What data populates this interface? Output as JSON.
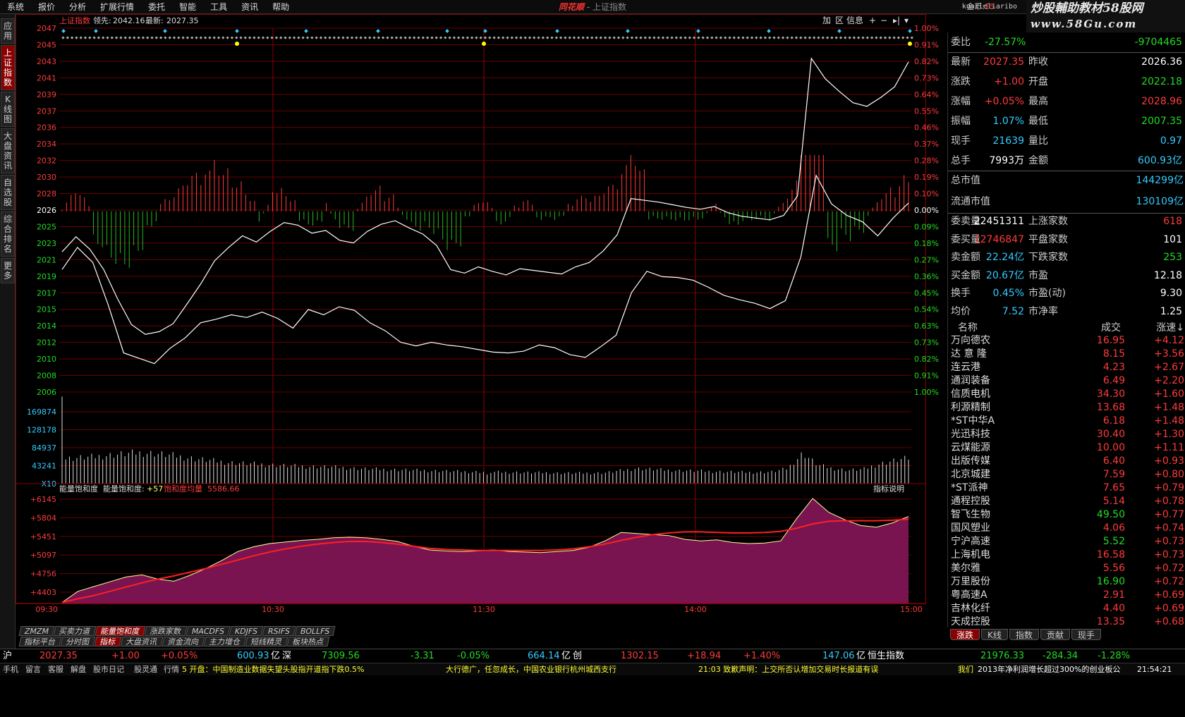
{
  "menu": [
    "系统",
    "报价",
    "分析",
    "扩展行情",
    "委托",
    "智能",
    "工具",
    "资讯",
    "帮助"
  ],
  "title": {
    "logo": "同花顺",
    "sep": " - ",
    "name": "上证指数"
  },
  "coin": {
    "label": "金币:",
    "value": "15"
  },
  "user": "kuaileliaribo",
  "watermark": {
    "line1": "炒股輔助教材58股网",
    "line2": "www.58Gu.com"
  },
  "left_tabs": [
    {
      "label": "应用",
      "active": false
    },
    {
      "label": "上证指数",
      "active": true
    },
    {
      "label": "K线图",
      "active": false
    },
    {
      "label": "大盘资讯",
      "active": false
    },
    {
      "label": "自选股",
      "active": false
    },
    {
      "label": "综合排名",
      "active": false
    },
    {
      "label": "更多",
      "active": false
    }
  ],
  "chart_header": {
    "name": "上证指数",
    "lead_label": "领先:",
    "lead": "2042.16",
    "latest_label": "最新:",
    "latest": "2027.35",
    "buttons": [
      "加",
      "区",
      "信息",
      "+",
      "−",
      "▸|",
      "▾"
    ]
  },
  "chart_data": [
    {
      "type": "line",
      "name": "intraday-price",
      "y_ticks": [
        "2047",
        "2045",
        "2043",
        "2041",
        "2039",
        "2037",
        "2036",
        "2034",
        "2032",
        "2030",
        "2028",
        "2026",
        "2025",
        "2023",
        "2021",
        "2019",
        "2017",
        "2015",
        "2014",
        "2012",
        "2010",
        "2008",
        "2006"
      ],
      "pct_ticks": [
        "1.00%",
        "0.91%",
        "0.82%",
        "0.73%",
        "0.64%",
        "0.55%",
        "0.46%",
        "0.37%",
        "0.28%",
        "0.19%",
        "0.10%",
        "0.00%",
        "0.09%",
        "0.18%",
        "0.27%",
        "0.36%",
        "0.45%",
        "0.54%",
        "0.63%",
        "0.73%",
        "0.82%",
        "0.91%",
        "1.00%"
      ],
      "ylim": [
        2006,
        2047
      ],
      "prev_close": 2026.36,
      "series": [
        {
          "values": [
            2021.8,
            2023.5,
            2022.1,
            2019.8,
            2016.5,
            2013.6,
            2012.5,
            2012.8,
            2013.7,
            2015.9,
            2018.2,
            2020.8,
            2022.3,
            2023.6,
            2022.9,
            2024.1,
            2025.1,
            2024.8,
            2023.9,
            2024.2,
            2023.1,
            2022.8,
            2024.1,
            2024.9,
            2025.3,
            2024.5,
            2023.8,
            2022.5,
            2019.8,
            2019.4,
            2020.1,
            2019.6,
            2019.2,
            2019.9,
            2019.7,
            2019.5,
            2019.3,
            2020.1,
            2020.6,
            2021.9,
            2023.7,
            2027.8,
            2027.6,
            2027.4,
            2027.1,
            2026.8,
            2026.6,
            2026.9,
            2026.2,
            2025.8,
            2025.6,
            2025.4,
            2025.9,
            2028.1,
            2043.6,
            2041.3,
            2039.9,
            2038.6,
            2038.2,
            2039.2,
            2040.4,
            2043.2
          ]
        },
        {
          "values": [
            2019.8,
            2022.3,
            2020.6,
            2015.8,
            2010.4,
            2009.8,
            2009.2,
            2010.9,
            2012.1,
            2013.8,
            2014.2,
            2014.7,
            2014.4,
            2015.0,
            2014.3,
            2013.2,
            2015.3,
            2014.7,
            2015.6,
            2015.2,
            2013.8,
            2012.9,
            2011.6,
            2011.2,
            2011.6,
            2011.3,
            2011.1,
            2010.8,
            2010.5,
            2010.4,
            2010.6,
            2011.3,
            2011.0,
            2010.2,
            2009.9,
            2011.1,
            2012.4,
            2017.2,
            2019.6,
            2019.0,
            2018.9,
            2018.6,
            2017.8,
            2016.9,
            2016.4,
            2016.0,
            2015.4,
            2016.3,
            2021.2,
            2030.4,
            2027.2,
            2025.9,
            2025.2,
            2023.6,
            2025.6,
            2027.3
          ]
        }
      ]
    },
    {
      "type": "bar",
      "name": "volume",
      "y_ticks": [
        "169874",
        "128178",
        "84937",
        "43241",
        "X10"
      ],
      "ylim": [
        0,
        212000
      ],
      "values": [
        58000,
        61000,
        63000,
        67000,
        70000,
        73000,
        72000,
        68000,
        63000,
        58000,
        54000,
        50000,
        48000,
        46000,
        44000,
        42000,
        41000,
        40000,
        39000,
        37000,
        35000,
        34000,
        33000,
        32000,
        31000,
        30000,
        29000,
        28000,
        28000,
        27000,
        27000,
        26000,
        26000,
        25000,
        25000,
        25000,
        26000,
        31000,
        36000,
        34000,
        32000,
        31000,
        30000,
        29000,
        28000,
        27000,
        27000,
        28000,
        36000,
        72000,
        44000,
        36000,
        32000,
        34000,
        46000,
        54000,
        60000
      ]
    },
    {
      "type": "area",
      "name": "energy-saturation",
      "label": "能量饱和度",
      "value_label": "能量饱和度:",
      "value": "+57",
      "ma_label": "饱和度均量",
      "ma_value": "5586.66",
      "y_ticks": [
        "+6145",
        "+5804",
        "+5451",
        "+5097",
        "+4756",
        "+4403"
      ],
      "ylim": [
        4100,
        6200
      ],
      "values": [
        4120,
        4330,
        4420,
        4510,
        4600,
        4640,
        4560,
        4520,
        4630,
        4760,
        4910,
        5080,
        5170,
        5230,
        5260,
        5290,
        5310,
        5340,
        5350,
        5340,
        5310,
        5270,
        5180,
        5110,
        5090,
        5080,
        5090,
        5110,
        5080,
        5070,
        5060,
        5080,
        5100,
        5160,
        5280,
        5440,
        5420,
        5400,
        5380,
        5310,
        5280,
        5300,
        5250,
        5230,
        5240,
        5280,
        5700,
        6080,
        5820,
        5680,
        5570,
        5540,
        5620,
        5740
      ],
      "ma_values": [
        4120,
        4190,
        4250,
        4330,
        4410,
        4490,
        4560,
        4620,
        4690,
        4760,
        4840,
        4920,
        5000,
        5070,
        5130,
        5180,
        5220,
        5250,
        5270,
        5270,
        5250,
        5220,
        5180,
        5140,
        5120,
        5110,
        5100,
        5100,
        5100,
        5100,
        5100,
        5110,
        5130,
        5170,
        5220,
        5290,
        5350,
        5400,
        5430,
        5450,
        5450,
        5440,
        5430,
        5430,
        5440,
        5460,
        5520,
        5600,
        5650,
        5660,
        5660,
        5660,
        5670,
        5690
      ]
    }
  ],
  "time_axis": [
    "09:30",
    "10:30",
    "11:30",
    "14:00",
    "15:00"
  ],
  "indicator_tabs_row1": [
    {
      "label": "ZMZM",
      "active": false
    },
    {
      "label": "买卖力道",
      "active": false
    },
    {
      "label": "能量饱和度",
      "active": true
    },
    {
      "label": "涨跌家数",
      "active": false
    },
    {
      "label": "MACDFS",
      "active": false
    },
    {
      "label": "KDJFS",
      "active": false
    },
    {
      "label": "RSIFS",
      "active": false
    },
    {
      "label": "BOLLFS",
      "active": false
    }
  ],
  "indicator_tabs_row2": [
    {
      "label": "指标平台",
      "active": false
    },
    {
      "label": "分时图",
      "active": false
    },
    {
      "label": "指标",
      "active": true
    },
    {
      "label": "大盘资讯",
      "active": false
    },
    {
      "label": "资金流向",
      "active": false
    },
    {
      "label": "主力增仓",
      "active": false
    },
    {
      "label": "短线精灵",
      "active": false
    },
    {
      "label": "板块热点",
      "active": false
    }
  ],
  "indicator_help": "指标说明",
  "quote": {
    "weibi": {
      "k": "委比",
      "v1": "-27.57%",
      "v2": "-9704465"
    },
    "rows": [
      {
        "k1": "最新",
        "v1": "2027.35",
        "c1": "#ff3b3b",
        "k2": "昨收",
        "v2": "2026.36",
        "c2": "#ffffff"
      },
      {
        "k1": "涨跌",
        "v1": "+1.00",
        "c1": "#ff3b3b",
        "k2": "开盘",
        "v2": "2022.18",
        "c2": "#22dd22"
      },
      {
        "k1": "涨幅",
        "v1": "+0.05%",
        "c1": "#ff3b3b",
        "k2": "最高",
        "v2": "2028.96",
        "c2": "#ff3b3b"
      },
      {
        "k1": "振幅",
        "v1": "1.07%",
        "c1": "#33ccff",
        "k2": "最低",
        "v2": "2007.35",
        "c2": "#22dd22"
      },
      {
        "k1": "现手",
        "v1": "21639",
        "c1": "#33ccff",
        "k2": "量比",
        "v2": "0.97",
        "c2": "#33ccff"
      },
      {
        "k1": "总手",
        "v1": "7993万",
        "c1": "#ffffff",
        "k2": "金额",
        "v2": "600.93亿",
        "c2": "#33ccff"
      }
    ],
    "mv": [
      {
        "k": "总市值",
        "v": "144299亿"
      },
      {
        "k": "流通市值",
        "v": "130109亿"
      }
    ],
    "rows2": [
      {
        "k1": "委卖量",
        "v1": "22451311",
        "c1": "#ffffff",
        "k2": "上涨家数",
        "v2": "618",
        "c2": "#ff3b3b"
      },
      {
        "k1": "委买量",
        "v1": "12746847",
        "c1": "#ff3b3b",
        "k2": "平盘家数",
        "v2": "101",
        "c2": "#ffffff"
      },
      {
        "k1": "卖金额",
        "v1": "22.24亿",
        "c1": "#33ccff",
        "k2": "下跌家数",
        "v2": "253",
        "c2": "#22dd22"
      },
      {
        "k1": "买金额",
        "v1": "20.67亿",
        "c1": "#33ccff",
        "k2": "市盈",
        "v2": "12.18",
        "c2": "#ffffff"
      },
      {
        "k1": "换手",
        "v1": "0.45%",
        "c1": "#33ccff",
        "k2": "市盈(动)",
        "v2": "9.30",
        "c2": "#ffffff"
      },
      {
        "k1": "均价",
        "v1": "7.52",
        "c1": "#33ccff",
        "k2": "市净率",
        "v2": "1.25",
        "c2": "#ffffff"
      }
    ]
  },
  "stocklist": {
    "headers": [
      "名称",
      "成交",
      "涨速↓"
    ],
    "rows": [
      {
        "n": "万向德农",
        "p": "16.95",
        "c": "+4.12"
      },
      {
        "n": "达 意 隆",
        "p": "8.15",
        "c": "+3.56"
      },
      {
        "n": "连云港",
        "p": "4.23",
        "c": "+2.67"
      },
      {
        "n": "通润装备",
        "p": "6.49",
        "c": "+2.20"
      },
      {
        "n": "信质电机",
        "p": "34.30",
        "c": "+1.60"
      },
      {
        "n": "利源精制",
        "p": "13.68",
        "c": "+1.48"
      },
      {
        "n": "*ST中华A",
        "p": "6.18",
        "c": "+1.48"
      },
      {
        "n": "光迅科技",
        "p": "30.40",
        "c": "+1.30"
      },
      {
        "n": "云煤能源",
        "p": "10.00",
        "c": "+1.11"
      },
      {
        "n": "出版传媒",
        "p": "6.40",
        "c": "+0.93"
      },
      {
        "n": "北京城建",
        "p": "7.59",
        "c": "+0.80"
      },
      {
        "n": "*ST派神",
        "p": "7.65",
        "c": "+0.79"
      },
      {
        "n": "通程控股",
        "p": "5.14",
        "c": "+0.78"
      },
      {
        "n": "智飞生物",
        "p": "49.50",
        "c": "+0.77",
        "pc": "#22dd22"
      },
      {
        "n": "国风塑业",
        "p": "4.06",
        "c": "+0.74"
      },
      {
        "n": "宁沪高速",
        "p": "5.52",
        "c": "+0.73",
        "pc": "#22dd22"
      },
      {
        "n": "上海机电",
        "p": "16.58",
        "c": "+0.73"
      },
      {
        "n": "美尔雅",
        "p": "5.56",
        "c": "+0.72"
      },
      {
        "n": "万里股份",
        "p": "16.90",
        "c": "+0.72",
        "pc": "#22dd22"
      },
      {
        "n": "粤高速A",
        "p": "2.91",
        "c": "+0.69"
      },
      {
        "n": "吉林化纤",
        "p": "4.40",
        "c": "+0.69"
      },
      {
        "n": "天成控股",
        "p": "13.35",
        "c": "+0.68"
      }
    ]
  },
  "right_tabs": [
    {
      "label": "涨跌",
      "active": true
    },
    {
      "label": "K线",
      "active": false
    },
    {
      "label": "指数",
      "active": false
    },
    {
      "label": "贡献",
      "active": false
    },
    {
      "label": "现手",
      "active": false
    }
  ],
  "ticker": {
    "sh_label": "沪",
    "sh_price": "2027.35",
    "sh_chg": "+1.00",
    "sh_pct": "+0.05%",
    "sh_amt": "600.93",
    "sh_unit": "亿",
    "sz_label": "深",
    "sz_price": "7309.56",
    "sz_chg": "-3.31",
    "sz_pct": "-0.05%",
    "sz_amt": "664.14",
    "sz_unit": "亿",
    "cy_label": "创",
    "cy_price": "1302.15",
    "cy_chg": "+18.94",
    "cy_pct": "+1.40%",
    "cy_amt": "147.06",
    "cy_unit": "亿",
    "hs_label": "恒生指数",
    "hs_price": "21976.33",
    "hs_chg": "-284.34",
    "hs_pct": "-1.28%",
    "time": "21:54:21"
  },
  "statusbar": {
    "items": [
      "手机",
      "留言",
      "客服",
      "解盘",
      "股市日记",
      "股灵通",
      "行情"
    ],
    "news1": "5 开盘：中国制造业数据失望头股指开道指下跌0.5%",
    "news2": "大行德广，任忽成长，中国农业银行杭州城西支行",
    "news3": "21:03 致歉声明：上交所否认增加交易时长报道有误",
    "news4": "我们",
    "news5": "2013年净利润增长超过300%的创业板公",
    "time": "21:54:21"
  }
}
